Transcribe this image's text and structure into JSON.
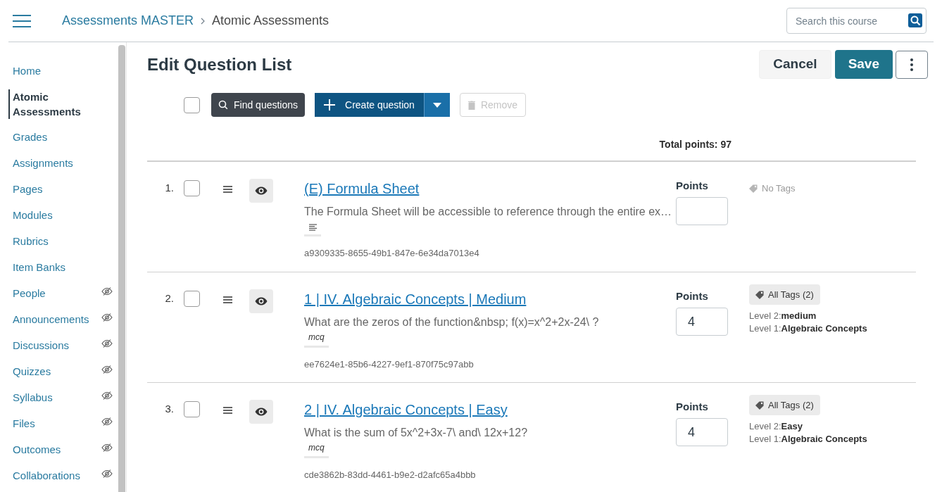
{
  "header": {
    "breadcrumb": [
      {
        "label": "Assessments MASTER",
        "kind": "link"
      },
      {
        "label": "Atomic Assessments",
        "kind": "current"
      }
    ],
    "search": {
      "placeholder": "Search this course"
    }
  },
  "sidebar": {
    "items": [
      {
        "label": "Home",
        "selected": false,
        "hidden": false
      },
      {
        "label": "Atomic Assessments",
        "selected": true,
        "hidden": false
      },
      {
        "label": "Grades",
        "selected": false,
        "hidden": false
      },
      {
        "label": "Assignments",
        "selected": false,
        "hidden": false
      },
      {
        "label": "Pages",
        "selected": false,
        "hidden": false
      },
      {
        "label": "Modules",
        "selected": false,
        "hidden": false
      },
      {
        "label": "Rubrics",
        "selected": false,
        "hidden": false
      },
      {
        "label": "Item Banks",
        "selected": false,
        "hidden": false
      },
      {
        "label": "People",
        "selected": false,
        "hidden": true
      },
      {
        "label": "Announcements",
        "selected": false,
        "hidden": true
      },
      {
        "label": "Discussions",
        "selected": false,
        "hidden": true
      },
      {
        "label": "Quizzes",
        "selected": false,
        "hidden": true
      },
      {
        "label": "Syllabus",
        "selected": false,
        "hidden": true
      },
      {
        "label": "Files",
        "selected": false,
        "hidden": true
      },
      {
        "label": "Outcomes",
        "selected": false,
        "hidden": true
      },
      {
        "label": "Collaborations",
        "selected": false,
        "hidden": true
      }
    ]
  },
  "page": {
    "title": "Edit Question List",
    "cancel": "Cancel",
    "save": "Save",
    "toolbar": {
      "select_all_checked": false,
      "find": "Find questions",
      "create": "Create question",
      "remove": "Remove",
      "remove_disabled": true
    },
    "total_points": "Total points: 97",
    "questions": [
      {
        "number": "1.",
        "checked": false,
        "title": "(E) Formula Sheet",
        "description": "The Formula Sheet will be accessible to reference through the entire ex…",
        "kind": "stimulus",
        "id": "a9309335-8655-49b1-847e-6e34da7013e4",
        "points_label": "Points",
        "tags": {
          "kind": "none",
          "label": "No Tags"
        }
      },
      {
        "number": "2.",
        "checked": false,
        "title": "1 | IV. Algebraic Concepts | Medium",
        "description": "What are the zeros of the function&nbsp; f(x)=x^2+2x-24\\ ?",
        "kind": "question",
        "type_label": "mcq",
        "id": "ee7624e1-85b6-4227-9ef1-870f75c97abb",
        "points_label": "Points",
        "points": "4",
        "tags": {
          "kind": "button",
          "label": "All Tags (2)",
          "lines": [
            "Level 2:**medium**",
            "Level 1:**Algebraic Concepts**"
          ]
        }
      },
      {
        "number": "3.",
        "checked": false,
        "title": "2 | IV. Algebraic Concepts | Easy",
        "description": "What is the sum of 5x^2+3x-7\\ and\\ 12x+12?",
        "kind": "question",
        "type_label": "mcq",
        "id": "cde3862b-83dd-4461-b9e2-d2afc65a4bbb",
        "points_label": "Points",
        "points": "4",
        "tags": {
          "kind": "button",
          "label": "All Tags (2)",
          "lines": [
            "Level 2:**Easy**",
            "Level 1:**Algebraic Concepts**"
          ]
        }
      }
    ]
  }
}
